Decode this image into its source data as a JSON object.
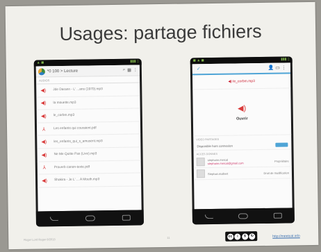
{
  "slide": {
    "title": "Usages: partage fichiers",
    "footer_left": "Roger Lord Roger 8/2013",
    "page_number": "11",
    "link": "http://meetcal.info"
  },
  "phone1": {
    "status_time": "",
    "appbar_title": "*0 100 > Lecture",
    "section_label": "AUDIOS",
    "files": [
      {
        "icon": "audio",
        "name": "Jde Darann - L' ...ans (1970).mp3"
      },
      {
        "icon": "audio",
        "name": "la mouette.mp3"
      },
      {
        "icon": "audio",
        "name": "le_corbm.mp3"
      },
      {
        "icon": "pdf",
        "name": "Les enfants qui couraient.pdf"
      },
      {
        "icon": "audio",
        "name": "les_enfants_qui_s_amusent.mp3"
      },
      {
        "icon": "audio",
        "name": "Ne Me Quitte Pas (Live).mp3"
      },
      {
        "icon": "pdf",
        "name": "Proverb canon-texte.pdf"
      },
      {
        "icon": "audio",
        "name": "Shakira - Je L' ... A Mouth.mp3"
      }
    ]
  },
  "phone2": {
    "shared_file": "le_corbm.mp3",
    "open_label": "Ouvrir",
    "section_share": "VIDEO PARTAGES",
    "available_label": "Disponible hors connexion",
    "section_access": "ACCES DONNES",
    "people": [
      {
        "name": "stephane.mercal",
        "email": "stephane.mercal@gmail.com",
        "role": "Propriétaire"
      },
      {
        "name": "Stephan.malbert",
        "email": "",
        "role": "Droit de modification"
      }
    ]
  },
  "colors": {
    "audio_icon": "#d93a3a",
    "accent": "#4ea4d6"
  }
}
